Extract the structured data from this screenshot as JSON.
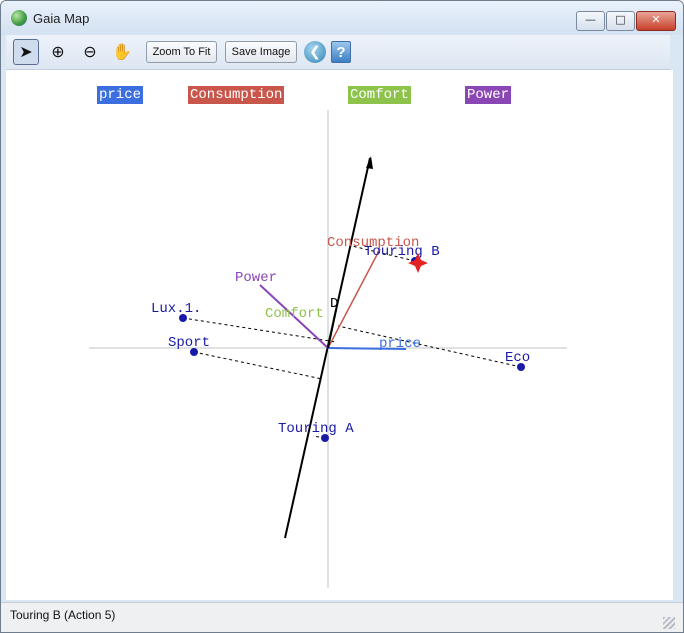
{
  "window": {
    "title": "Gaia Map",
    "controls": {
      "minimize": "—",
      "maximize": "□",
      "close": "✕"
    }
  },
  "toolbar": {
    "tools": [
      {
        "name": "pointer-tool",
        "glyph": "➤",
        "selected": true
      },
      {
        "name": "zoom-in-tool",
        "glyph": "⊕",
        "selected": false
      },
      {
        "name": "zoom-out-tool",
        "glyph": "⊖",
        "selected": false
      },
      {
        "name": "pan-tool",
        "glyph": "✋",
        "selected": false
      }
    ],
    "zoom_to_fit_label": "Zoom To Fit",
    "save_image_label": "Save Image",
    "back_glyph": "❮",
    "help_glyph": "?"
  },
  "legend": [
    {
      "label": "price",
      "color": "#3b6fe0"
    },
    {
      "label": "Consumption",
      "color": "#c8564a"
    },
    {
      "label": "Comfort",
      "color": "#8dc34a"
    },
    {
      "label": "Power",
      "color": "#8b46b5"
    }
  ],
  "map": {
    "center_label": "D",
    "colors": {
      "action": "#1a1aa8",
      "price": "#3b6fe0",
      "consumption": "#c8564a",
      "comfort": "#8dc34a",
      "power": "#8b46b5",
      "axis": "#bfc3c8",
      "decision_axis": "#000000",
      "selected_marker": "#e52222"
    },
    "criteria": [
      {
        "id": "price",
        "label": "price"
      },
      {
        "id": "consumption",
        "label": "Consumption"
      },
      {
        "id": "comfort",
        "label": "Comfort"
      },
      {
        "id": "power",
        "label": "Power"
      }
    ],
    "actions": [
      {
        "id": "lux",
        "label": "Lux.1."
      },
      {
        "id": "sport",
        "label": "Sport"
      },
      {
        "id": "touring_b",
        "label": "Touring B"
      },
      {
        "id": "eco",
        "label": "Eco"
      },
      {
        "id": "touring_a",
        "label": "Touring A"
      }
    ],
    "selected_action": "touring_b"
  },
  "status": {
    "text": "Touring B (Action 5)"
  }
}
